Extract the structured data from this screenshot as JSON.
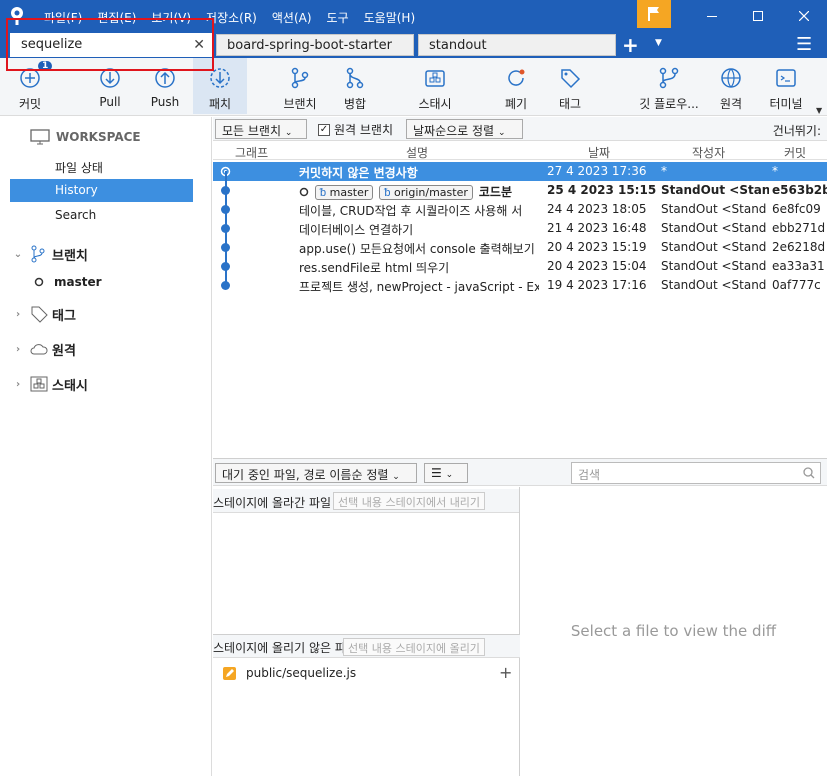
{
  "menu": [
    "파일(F)",
    "편집(E)",
    "보기(V)",
    "저장소(R)",
    "액션(A)",
    "도구",
    "도움말(H)"
  ],
  "tabs": [
    {
      "label": "sequelize",
      "active": true
    },
    {
      "label": "board-spring-boot-starter",
      "active": false
    },
    {
      "label": "standout",
      "active": false
    }
  ],
  "toolbar": {
    "commit_badge": "1",
    "buttons": [
      {
        "label": "커밋",
        "icon": "commit-icon"
      },
      {
        "label": "Pull",
        "icon": "pull-icon"
      },
      {
        "label": "Push",
        "icon": "push-icon"
      },
      {
        "label": "패치",
        "icon": "fetch-icon"
      },
      {
        "label": "브랜치",
        "icon": "branch-icon"
      },
      {
        "label": "병합",
        "icon": "merge-icon"
      },
      {
        "label": "스태시",
        "icon": "stash-icon"
      },
      {
        "label": "폐기",
        "icon": "discard-icon"
      },
      {
        "label": "태그",
        "icon": "tag-icon"
      },
      {
        "label": "깃 플로우...",
        "icon": "gitflow-icon"
      },
      {
        "label": "원격",
        "icon": "remote-icon"
      },
      {
        "label": "터미널",
        "icon": "terminal-icon"
      }
    ]
  },
  "sidebar": {
    "workspace": "WORKSPACE",
    "file_status": "파일 상태",
    "history": "History",
    "search": "Search",
    "branches": "브랜치",
    "branch_master": "master",
    "tags": "태그",
    "remotes": "원격",
    "stashes": "스태시"
  },
  "filter": {
    "branches_dd": "모든 브랜치",
    "remote_branch": "원격 브랜치",
    "sort_dd": "날짜순으로 정렬",
    "skip": "건너뛰기:"
  },
  "columns": {
    "graph": "그래프",
    "desc": "설명",
    "date": "날짜",
    "author": "작성자",
    "commit": "커밋"
  },
  "commits": [
    {
      "desc": "커밋하지 않은 변경사항",
      "date": "27 4 2023 17:36",
      "author": "*",
      "hash": "*"
    },
    {
      "desc": "코드분",
      "refs": [
        "master",
        "origin/master"
      ],
      "date": "25 4 2023 15:15",
      "author": "StandOut <Stand",
      "hash": "e563b2b"
    },
    {
      "desc": "테이블, CRUD작업 후 시퀄라이즈 사용해 서",
      "date": "24 4 2023 18:05",
      "author": "StandOut <Stand",
      "hash": "6e8fc09"
    },
    {
      "desc": "데이터베이스 연결하기",
      "date": "21 4 2023 16:48",
      "author": "StandOut <Stand",
      "hash": "ebb271d"
    },
    {
      "desc": "app.use() 모든요청에서 console 출력해보기",
      "date": "20 4 2023 15:19",
      "author": "StandOut <Stand",
      "hash": "2e6218d"
    },
    {
      "desc": "res.sendFile로 html 띄우기",
      "date": "20 4 2023 15:04",
      "author": "StandOut <Stand",
      "hash": "ea33a31"
    },
    {
      "desc": "프로젝트 생성, newProject - javaScript - Exp",
      "date": "19 4 2023 17:16",
      "author": "StandOut <Stand",
      "hash": "0af777c"
    }
  ],
  "lower": {
    "pending_dd": "대기 중인 파일, 경로 이름순 정렬",
    "search_placeholder": "검색",
    "staged_title": "스테이지에 올라간 파일",
    "staged_action": "선택 내용 스테이지에서 내리기",
    "unstaged_title": "스테이지에 올리기 않은 파일",
    "unstaged_action": "선택 내용 스테이지에 올리기",
    "file": "public/sequelize.js",
    "diff_placeholder": "Select a file to view the diff"
  }
}
